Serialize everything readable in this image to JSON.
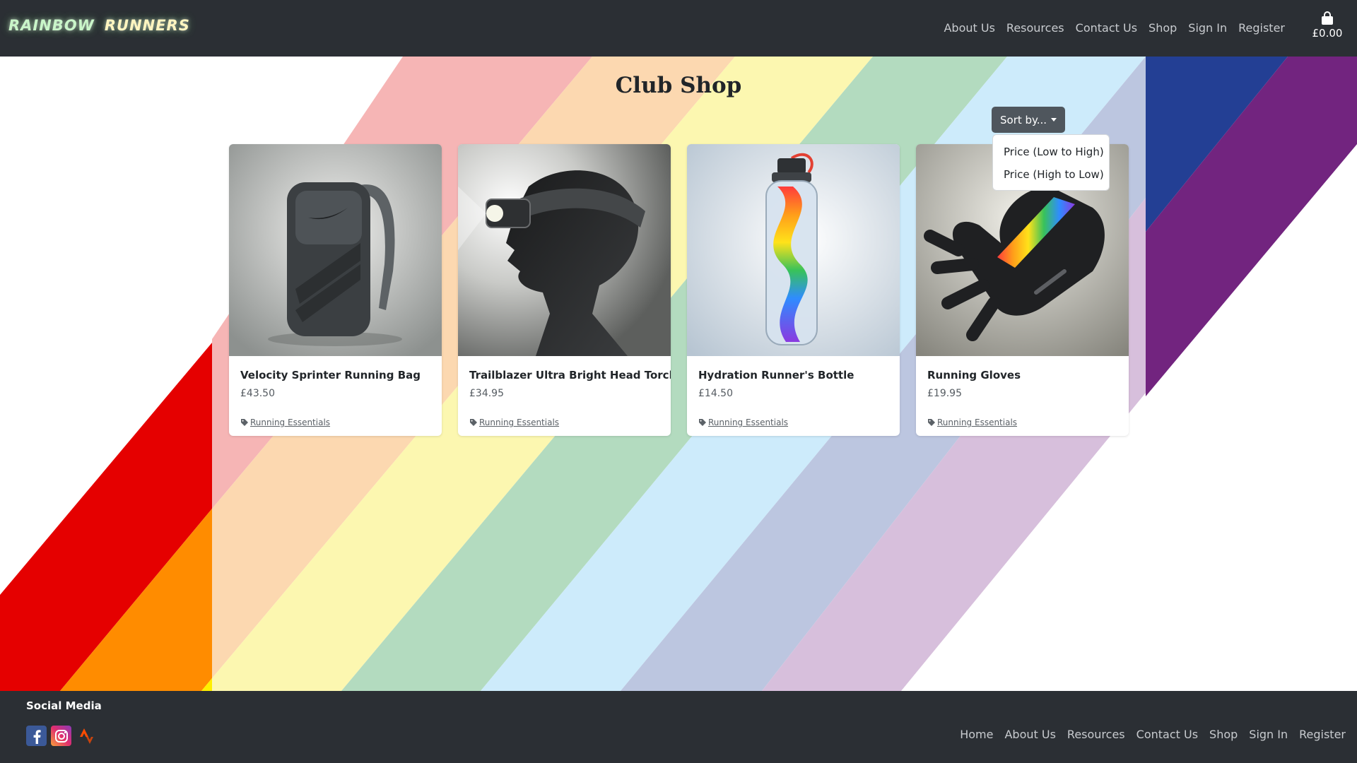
{
  "brand": {
    "word1": "RAINBOW",
    "word2": "RUNNERS"
  },
  "nav": {
    "links": [
      "About Us",
      "Resources",
      "Contact Us",
      "Shop",
      "Sign In",
      "Register"
    ],
    "cart_total": "£0.00"
  },
  "main": {
    "title": "Club Shop",
    "sort": {
      "label": "Sort by...",
      "options": [
        "Price (Low to High)",
        "Price (High to Low)"
      ]
    },
    "products": [
      {
        "name": "Velocity Sprinter Running Bag",
        "price": "£43.50",
        "category": "Running Essentials",
        "image": "backpack"
      },
      {
        "name": "Trailblazer Ultra Bright Head Torch",
        "price": "£34.95",
        "category": "Running Essentials",
        "image": "head-torch"
      },
      {
        "name": "Hydration Runner's Bottle",
        "price": "£14.50",
        "category": "Running Essentials",
        "image": "rainbow-water-bottle"
      },
      {
        "name": "Running Gloves",
        "price": "£19.95",
        "category": "Running Essentials",
        "image": "rainbow-gloves"
      }
    ]
  },
  "footer": {
    "social_heading": "Social Media",
    "social": [
      "facebook-icon",
      "instagram-icon",
      "strava-icon"
    ],
    "links": [
      "Home",
      "About Us",
      "Resources",
      "Contact Us",
      "Shop",
      "Sign In",
      "Register"
    ]
  },
  "colors": {
    "navbar": "#2b2f34",
    "rainbow": [
      "#e50000",
      "#ff8c00",
      "#ffef00",
      "#00811f",
      "#0044ff",
      "#760089"
    ],
    "pastel": [
      "#f6b5b5",
      "#fcd8b0",
      "#fcf7b0",
      "#b3dbbf",
      "#cdebfb",
      "#bcc6e0",
      "#d7bfdc"
    ]
  }
}
